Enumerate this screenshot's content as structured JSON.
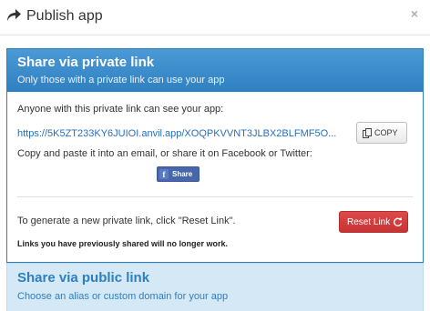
{
  "header": {
    "title": "Publish app",
    "close_label": "×"
  },
  "private_panel": {
    "title": "Share via private link",
    "subtitle": "Only those with a private link can use your app",
    "intro": "Anyone with this private link can see your app:",
    "link": "https://5K5ZT233KY6JUIOI.anvil.app/XOQPKVVNT3JLBX2BLFMF5O...",
    "copy_label": "COPY",
    "paste_text": "Copy and paste it into an email, or share it on Facebook or Twitter:",
    "facebook_label": "Share",
    "reset_text": "To generate a new private link, click \"Reset Link\".",
    "reset_label": "Reset Link",
    "warning": "Links you have previously shared will no longer work."
  },
  "public_panel": {
    "title": "Share via public link",
    "subtitle": "Choose an alias or custom domain for your app"
  },
  "colors": {
    "primary_blue": "#2f80c2",
    "link_blue": "#2a6ebb",
    "danger_red": "#d04040",
    "facebook_blue": "#4867aa",
    "public_panel_bg": "#d5e8f5"
  },
  "icons": [
    "share-arrow-icon",
    "close-icon",
    "copy-icon",
    "facebook-icon",
    "refresh-icon"
  ]
}
